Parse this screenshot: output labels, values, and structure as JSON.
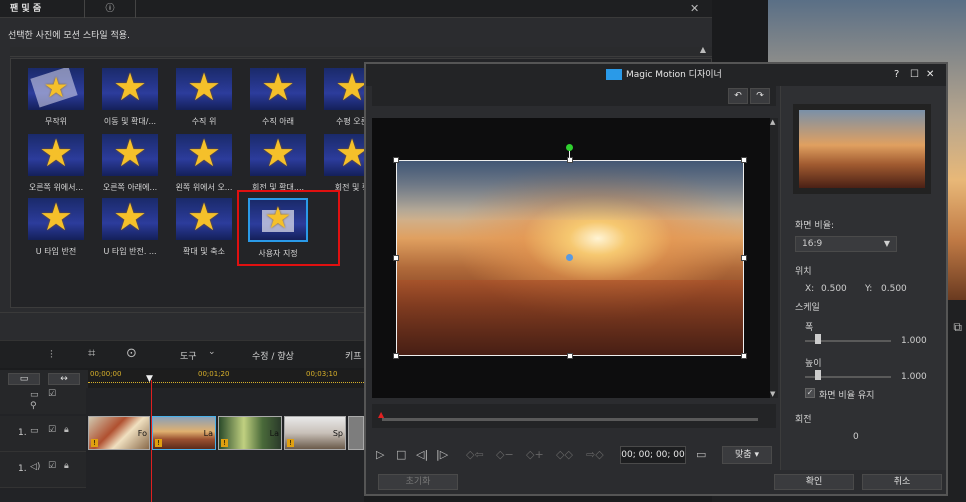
{
  "panel": {
    "tab_title": "팬 및 줌",
    "info_icon": "ⓘ",
    "close": "✕",
    "instruction": "선택한 사진에 모션 스타일 적용.",
    "tiles": [
      {
        "label": "무작위"
      },
      {
        "label": "이동 및 확대/..."
      },
      {
        "label": "수직 위"
      },
      {
        "label": "수직 아래"
      },
      {
        "label": "수평 오른"
      },
      {
        "label": "오른쪽 위에서..."
      },
      {
        "label": "오른쪽 아래에..."
      },
      {
        "label": "왼쪽 위에서 오..."
      },
      {
        "label": "회전 및 확대...."
      },
      {
        "label": "회전 및 확"
      },
      {
        "label": "U 타입 반전"
      },
      {
        "label": "U 타입 반전. ..."
      },
      {
        "label": "확대 및 축소"
      },
      {
        "label": "사용자 지정"
      }
    ]
  },
  "toolbar": {
    "tools_label": "도구",
    "edit_label": "수정 / 향상",
    "keyframe_label": "키프"
  },
  "timeline": {
    "ruler": [
      "00;00;00",
      "00;01;20",
      "00;03;10"
    ],
    "track1_label": "1.",
    "track2_label": "1.",
    "clips": [
      {
        "label": "Fo"
      },
      {
        "label": "La"
      },
      {
        "label": "La"
      },
      {
        "label": "Sp"
      }
    ]
  },
  "dialog": {
    "title": "Magic Motion 디자이너",
    "help": "?",
    "aspect_label": "화면 비율:",
    "aspect_value": "16:9",
    "position_label": "위치",
    "x_label": "X:",
    "x_value": "0.500",
    "y_label": "Y:",
    "y_value": "0.500",
    "scale_label": "스케일",
    "width_label": "폭",
    "width_value": "1.000",
    "height_label": "높이",
    "height_value": "1.000",
    "keep_ratio_label": "화면 비율 유지",
    "rotation_label": "회전",
    "rotation_value": "0",
    "timecode": "00; 00; 00; 00",
    "fit_label": "맞춤",
    "reset_label": "초기화",
    "ok_label": "확인",
    "cancel_label": "취소"
  }
}
